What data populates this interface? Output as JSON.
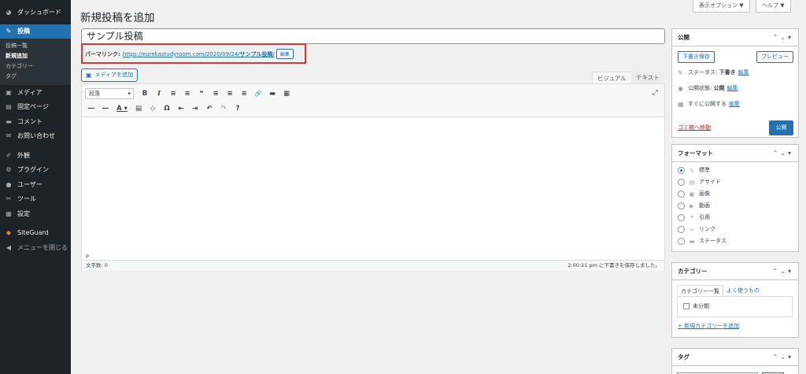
{
  "sidebar": {
    "items": [
      {
        "icon": "dashboard-icon",
        "glyph": "◕",
        "label": "ダッシュボード"
      },
      {
        "icon": "pin-icon",
        "glyph": "✎",
        "label": "投稿",
        "active": true
      },
      {
        "icon": "media-icon",
        "glyph": "▣",
        "label": "メディア"
      },
      {
        "icon": "page-icon",
        "glyph": "▤",
        "label": "固定ページ"
      },
      {
        "icon": "comment-icon",
        "glyph": "▬",
        "label": "コメント"
      },
      {
        "icon": "mail-icon",
        "glyph": "✉",
        "label": "お問い合わせ"
      },
      {
        "icon": "appearance-icon",
        "glyph": "✐",
        "label": "外観"
      },
      {
        "icon": "plugin-icon",
        "glyph": "⚙",
        "label": "プラグイン"
      },
      {
        "icon": "user-icon",
        "glyph": "●",
        "label": "ユーザー"
      },
      {
        "icon": "tool-icon",
        "glyph": "✂",
        "label": "ツール"
      },
      {
        "icon": "settings-icon",
        "glyph": "▦",
        "label": "設定"
      },
      {
        "icon": "siteguard-icon",
        "glyph": "◆",
        "label": "SiteGuard"
      },
      {
        "icon": "collapse-icon",
        "glyph": "◀",
        "label": "メニューを閉じる"
      }
    ],
    "submenu": [
      "投稿一覧",
      "新規追加",
      "カテゴリー",
      "タグ"
    ]
  },
  "header": {
    "title": "新規投稿を追加",
    "screen_options": "表示オプション ▼",
    "help": "ヘルプ ▼"
  },
  "post": {
    "title": "サンプル投稿",
    "permalink_label": "パーマリンク:",
    "permalink_url": "https://eurekastudyroom.com/2020/09/24/",
    "permalink_slug": "サンプル投稿",
    "permalink_tail": "/",
    "edit_label": "編集"
  },
  "editor": {
    "add_media": "メディアを追加",
    "tab_visual": "ビジュアル",
    "tab_text": "テキスト",
    "format_select": "段落",
    "path": "P",
    "word_count": "文字数: 0",
    "saved_status": "2:00:21 pm に下書きを保存しました。",
    "toolbar_row1": [
      "B",
      "I",
      "≡",
      "≡",
      "❝",
      "≡",
      "≡",
      "≡",
      "🔗",
      "▬",
      "▦"
    ],
    "toolbar_row2": [
      "—",
      "—",
      "A ▾",
      "▤",
      "◇",
      "Ω",
      "⇤",
      "⇥",
      "↶",
      "↷",
      "?"
    ]
  },
  "publish": {
    "heading": "公開",
    "save_draft": "下書き保存",
    "preview": "プレビュー",
    "status_label": "ステータス:",
    "status_value": "下書き",
    "visibility_label": "公開状態:",
    "visibility_value": "公開",
    "schedule_label": "すぐに公開する",
    "edit": "編集",
    "trash": "ゴミ箱へ移動",
    "publish": "公開"
  },
  "format": {
    "heading": "フォーマット",
    "options": [
      {
        "label": "標準",
        "glyph": "✎",
        "checked": true
      },
      {
        "label": "アサイド",
        "glyph": "▤"
      },
      {
        "label": "画像",
        "glyph": "▣"
      },
      {
        "label": "動画",
        "glyph": "▶"
      },
      {
        "label": "引用",
        "glyph": "❝"
      },
      {
        "label": "リンク",
        "glyph": "∞"
      },
      {
        "label": "ステータス",
        "glyph": "▬"
      }
    ]
  },
  "category": {
    "heading": "カテゴリー",
    "tab_all": "カテゴリー一覧",
    "tab_popular": "よく使うもの",
    "items": [
      "未分類"
    ],
    "add_new": "+ 新規カテゴリーを追加"
  },
  "tag": {
    "heading": "タグ"
  }
}
